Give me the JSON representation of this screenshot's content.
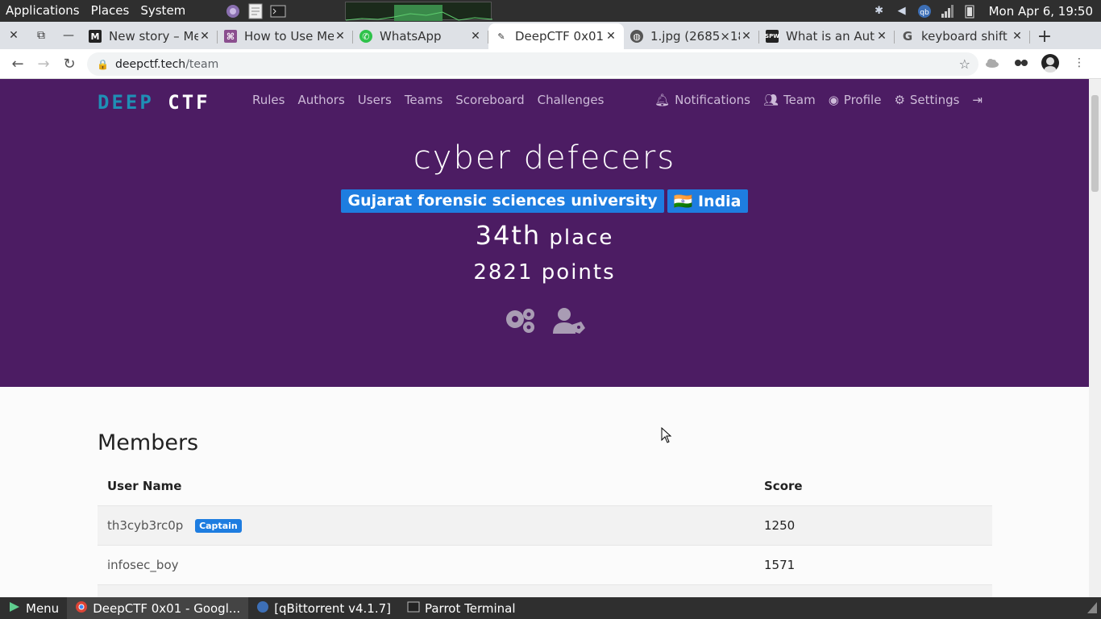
{
  "system_top": {
    "menus": [
      "Applications",
      "Places",
      "System"
    ],
    "clock": "Mon Apr  6, 19:50"
  },
  "browser": {
    "tabs": [
      {
        "title": "New story – Me",
        "icon": "medium-icon"
      },
      {
        "title": "How to Use Me",
        "icon": "bookmark-icon"
      },
      {
        "title": "WhatsApp",
        "icon": "whatsapp-icon"
      },
      {
        "title": "DeepCTF 0x01",
        "icon": "deepctf-icon",
        "active": true
      },
      {
        "title": "1.jpg (2685×18",
        "icon": "globe-icon"
      },
      {
        "title": "What is an Auto",
        "icon": "site-icon"
      },
      {
        "title": "keyboard shift",
        "icon": "google-icon"
      }
    ],
    "url_host": "deepctf.tech",
    "url_path": "/team"
  },
  "site": {
    "logo_part1": "DEEP",
    "logo_part2": "CTF",
    "nav": [
      "Rules",
      "Authors",
      "Users",
      "Teams",
      "Scoreboard",
      "Challenges"
    ],
    "nav_right": [
      "Notifications",
      "Team",
      "Profile",
      "Settings"
    ],
    "team_name": "cyber defecers",
    "affiliation": "Gujarat forensic sciences university",
    "country": "🇮🇳 India",
    "place_num": "34th",
    "place_label": "place",
    "points_num": "2821",
    "points_label": "points"
  },
  "members": {
    "heading": "Members",
    "columns": [
      "User Name",
      "Score"
    ],
    "rows": [
      {
        "name": "th3cyb3rc0p",
        "badge": "Captain",
        "score": "1250"
      },
      {
        "name": "infosec_boy",
        "badge": "",
        "score": "1571"
      }
    ]
  },
  "system_bottom": {
    "menu": "Menu",
    "tasks": [
      "DeepCTF 0x01 - Googl...",
      "[qBittorrent v4.1.7]",
      "Parrot Terminal"
    ]
  }
}
